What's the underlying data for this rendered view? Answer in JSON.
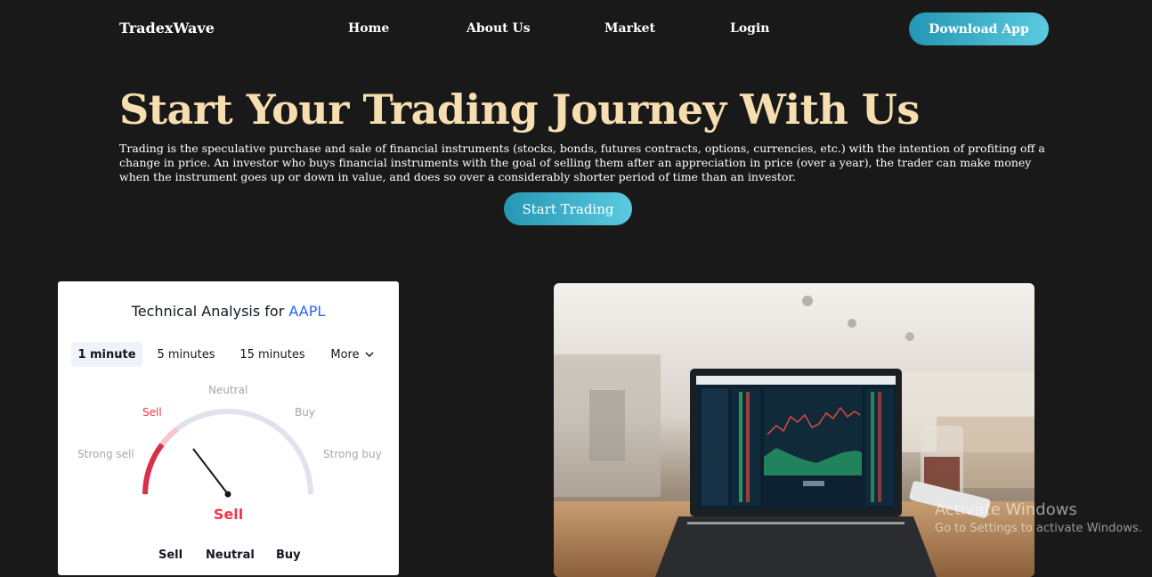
{
  "nav": {
    "brand": "TradexWave",
    "links": [
      "Home",
      "About Us",
      "Market",
      "Login"
    ],
    "download_label": "Download App"
  },
  "hero": {
    "title": "Start Your Trading Journey With Us",
    "description": "Trading is the speculative purchase and sale of financial instruments (stocks, bonds, futures contracts, options, currencies, etc.) with the intention of profiting off a change in price. An investor who buys financial instruments with the goal of selling them after an appreciation in price (over a year), the trader can make money when the instrument goes up or down in value, and does so over a considerably shorter period of time than an investor.",
    "cta_label": "Start Trading"
  },
  "widget": {
    "title_prefix": "Technical Analysis for",
    "symbol": "AAPL",
    "tabs": [
      "1 minute",
      "5 minutes",
      "15 minutes",
      "More"
    ],
    "active_tab": "1 minute",
    "gauge_labels": {
      "strong_sell": "Strong sell",
      "sell": "Sell",
      "neutral": "Neutral",
      "buy": "Buy",
      "strong_buy": "Strong buy"
    },
    "result": "Sell",
    "bottom_labels": [
      "Sell",
      "Neutral",
      "Buy"
    ],
    "colors": {
      "sell": "#f23645",
      "accent": "#2962ff",
      "track": "#e0e3eb"
    }
  },
  "watermark": {
    "line1": "Activate Windows",
    "line2": "Go to Settings to activate Windows."
  }
}
